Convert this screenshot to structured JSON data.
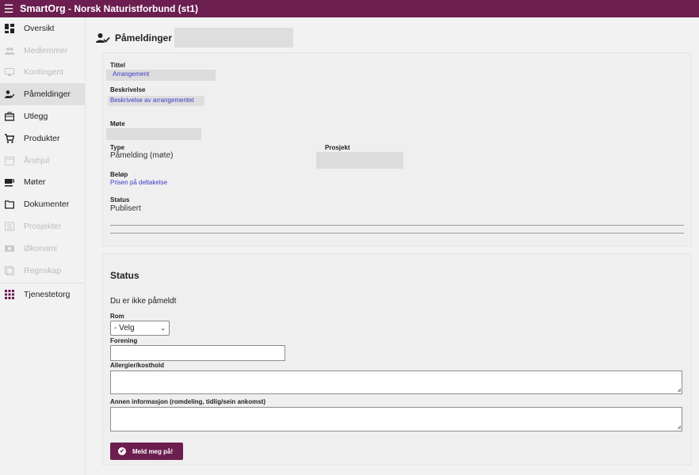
{
  "header": {
    "app": "SmartOrg",
    "org": " - Norsk Naturistforbund (st1)"
  },
  "sidebar": {
    "items": [
      {
        "label": "Oversikt",
        "icon": "dashboard-icon",
        "disabled": false,
        "active": false
      },
      {
        "label": "Medlemmer",
        "icon": "members-icon",
        "disabled": true,
        "active": false
      },
      {
        "label": "Kontingent",
        "icon": "payment-icon",
        "disabled": true,
        "active": false
      },
      {
        "label": "Påmeldinger",
        "icon": "person-check-icon",
        "disabled": false,
        "active": true
      },
      {
        "label": "Utlegg",
        "icon": "briefcase-icon",
        "disabled": false,
        "active": false
      },
      {
        "label": "Produkter",
        "icon": "cart-icon",
        "disabled": false,
        "active": false
      },
      {
        "label": "Årshjul",
        "icon": "calendar-icon",
        "disabled": true,
        "active": false
      },
      {
        "label": "Møter",
        "icon": "cup-icon",
        "disabled": false,
        "active": false
      },
      {
        "label": "Dokumenter",
        "icon": "folder-icon",
        "disabled": false,
        "active": false
      },
      {
        "label": "Prosjekter",
        "icon": "project-icon",
        "disabled": true,
        "active": false
      },
      {
        "label": "Økonomi",
        "icon": "economy-icon",
        "disabled": true,
        "active": false
      },
      {
        "label": "Regnskap",
        "icon": "accounting-icon",
        "disabled": true,
        "active": false
      },
      {
        "label": "Tjenestetorg",
        "icon": "grid-icon",
        "disabled": false,
        "active": false
      }
    ]
  },
  "page": {
    "title": "Påmeldinger"
  },
  "details": {
    "tittel_label": "Tittel",
    "tittel_value": "Arrangement",
    "beskrivelse_label": "Beskrivelse",
    "beskrivelse_value": "Beskrivelse av arrangementet",
    "mote_label": "Møte",
    "type_label": "Type",
    "type_value": "Påmelding (møte)",
    "prosjekt_label": "Prosjekt",
    "belop_label": "Beløp",
    "belop_value": "Prisen på deltakelse",
    "status_label": "Status",
    "status_value": "Publisert"
  },
  "status": {
    "title": "Status",
    "text": "Du er ikke påmeldt",
    "rom_label": "Rom",
    "rom_value": "- Velg",
    "forening_label": "Forening",
    "allergier_label": "Allergier/kosthold",
    "annen_label": "Annen informasjon (romdeling, tidlig/sein ankomst)",
    "button_label": "Meld meg på!"
  },
  "colors": {
    "brand": "#6b1e4f",
    "link": "#3b3bc9"
  }
}
